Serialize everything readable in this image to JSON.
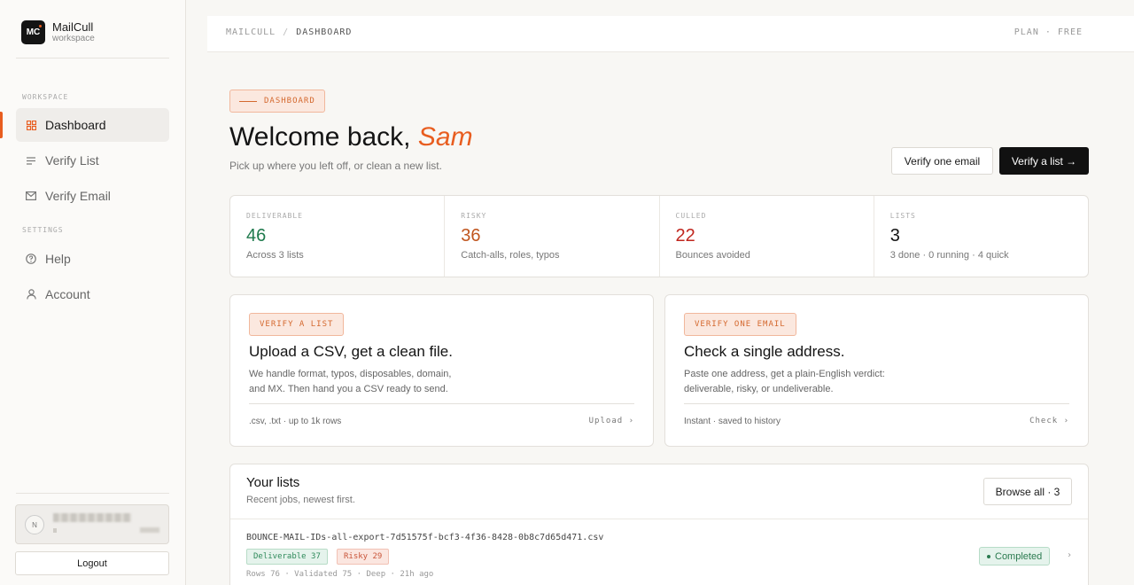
{
  "brand": {
    "logo": "MC",
    "name": "MailCull",
    "sub": "workspace"
  },
  "sidebar": {
    "sections": {
      "workspace": "WORKSPACE",
      "settings": "SETTINGS"
    },
    "items": [
      {
        "label": "Dashboard",
        "icon": "grid-icon"
      },
      {
        "label": "Verify List",
        "icon": "list-icon"
      },
      {
        "label": "Verify Email",
        "icon": "mail-icon"
      },
      {
        "label": "Help",
        "icon": "help-icon"
      },
      {
        "label": "Account",
        "icon": "user-icon"
      }
    ],
    "user": {
      "initial": "N"
    },
    "logout": "Logout"
  },
  "topbar": {
    "crumb_root": "MAILCULL",
    "crumb_sep": "/",
    "crumb_current": "DASHBOARD",
    "plan": "PLAN · FREE"
  },
  "hero": {
    "tag": "DASHBOARD",
    "welcome": "Welcome back,",
    "name": "Sam",
    "subtitle": "Pick up where you left off, or clean a new list.",
    "btn_one": "Verify one email",
    "btn_list": "Verify a list →"
  },
  "stats": [
    {
      "label": "DELIVERABLE",
      "value": "46",
      "sub": "Across 3 lists"
    },
    {
      "label": "RISKY",
      "value": "36",
      "sub": "Catch-alls, roles, typos"
    },
    {
      "label": "CULLED",
      "value": "22",
      "sub": "Bounces avoided"
    },
    {
      "label": "LISTS",
      "value": "3",
      "sub": "3 done · 0 running · 4 quick"
    }
  ],
  "cards": [
    {
      "tag": "VERIFY A LIST",
      "title": "Upload a CSV, get a clean file.",
      "desc1": "We handle format, typos, disposables, domain,",
      "desc2": "and MX. Then hand you a CSV ready to send.",
      "foot": ".csv, .txt · up to 1k rows",
      "link": "Upload ›"
    },
    {
      "tag": "VERIFY ONE EMAIL",
      "title": "Check a single address.",
      "desc1": "Paste one address, get a plain-English verdict:",
      "desc2": "deliverable, risky, or undeliverable.",
      "foot": "Instant · saved to history",
      "link": "Check ›"
    }
  ],
  "lists": {
    "title": "Your lists",
    "sub": "Recent jobs, newest first.",
    "browse": "Browse all · 3",
    "rows": [
      {
        "name": "BOUNCE-MAIL-IDs-all-export-7d51575f-bcf3-4f36-8428-0b8c7d65d471.csv",
        "deliverable": "Deliverable 37",
        "risky": "Risky 29",
        "meta": "Rows 76 · Validated 75 · Deep · 21h ago",
        "status": "Completed",
        "more": "›"
      }
    ]
  },
  "colors": {
    "accent": "#e85d1f",
    "green": "#1f7a4d",
    "orange": "#c0551e",
    "red": "#c0261e"
  }
}
